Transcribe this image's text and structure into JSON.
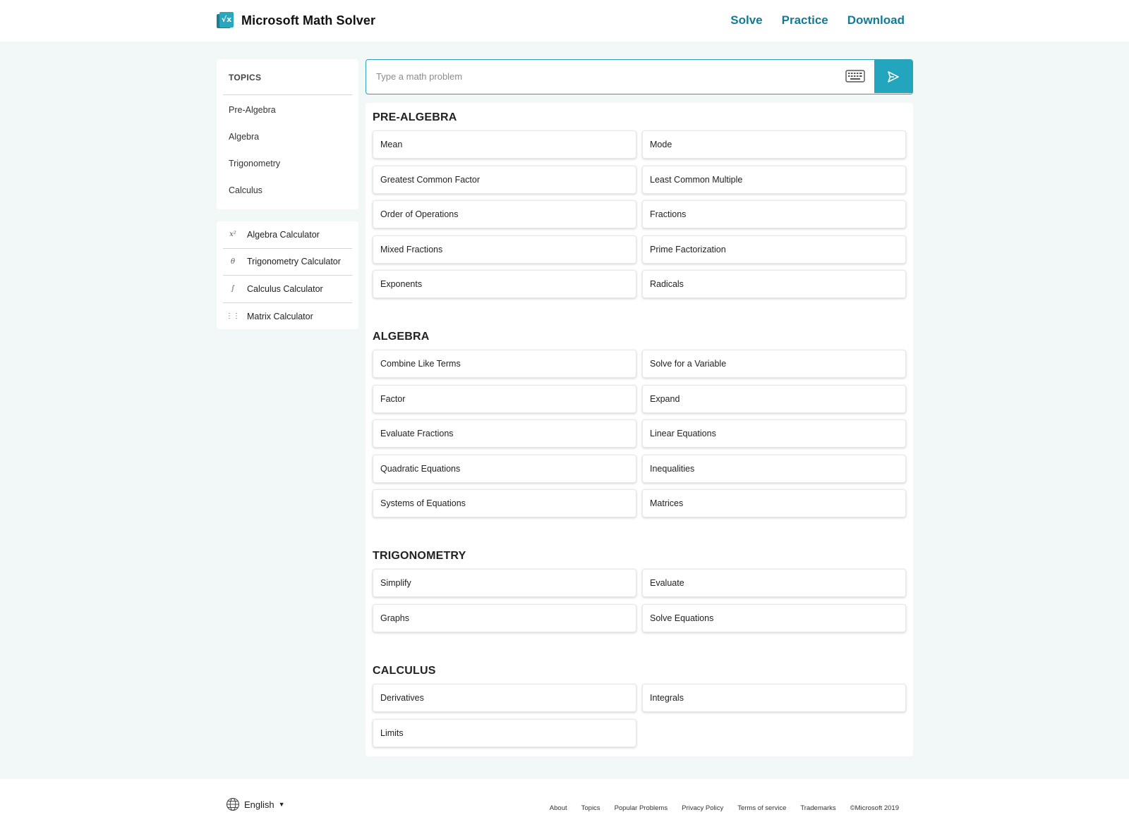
{
  "header": {
    "brand": "Microsoft Math Solver",
    "logo_glyph": "√x",
    "nav": [
      "Solve",
      "Practice",
      "Download"
    ]
  },
  "sidebar": {
    "topics_title": "TOPICS",
    "topics": [
      "Pre-Algebra",
      "Algebra",
      "Trigonometry",
      "Calculus"
    ],
    "calculators": [
      {
        "icon": "x²",
        "label": "Algebra Calculator"
      },
      {
        "icon": "θ",
        "label": "Trigonometry Calculator"
      },
      {
        "icon": "∫",
        "label": "Calculus Calculator"
      },
      {
        "icon": "⋮⋮",
        "label": "Matrix Calculator"
      }
    ]
  },
  "search": {
    "placeholder": "Type a math problem",
    "value": ""
  },
  "sections": [
    {
      "title": "PRE-ALGEBRA",
      "items": [
        "Mean",
        "Mode",
        "Greatest Common Factor",
        "Least Common Multiple",
        "Order of Operations",
        "Fractions",
        "Mixed Fractions",
        "Prime Factorization",
        "Exponents",
        "Radicals"
      ]
    },
    {
      "title": "ALGEBRA",
      "items": [
        "Combine Like Terms",
        "Solve for a Variable",
        "Factor",
        "Expand",
        "Evaluate Fractions",
        "Linear Equations",
        "Quadratic Equations",
        "Inequalities",
        "Systems of Equations",
        "Matrices"
      ]
    },
    {
      "title": "TRIGONOMETRY",
      "items": [
        "Simplify",
        "Evaluate",
        "Graphs",
        "Solve Equations"
      ]
    },
    {
      "title": "CALCULUS",
      "items": [
        "Derivatives",
        "Integrals",
        "Limits"
      ]
    }
  ],
  "footer": {
    "language": "English",
    "links": [
      "About",
      "Topics",
      "Popular Problems",
      "Privacy Policy",
      "Terms of service",
      "Trademarks"
    ],
    "copyright": "©Microsoft 2019"
  },
  "colors": {
    "accent": "#23a5bd",
    "nav_link": "#127b96",
    "background": "#f2f7f7"
  }
}
